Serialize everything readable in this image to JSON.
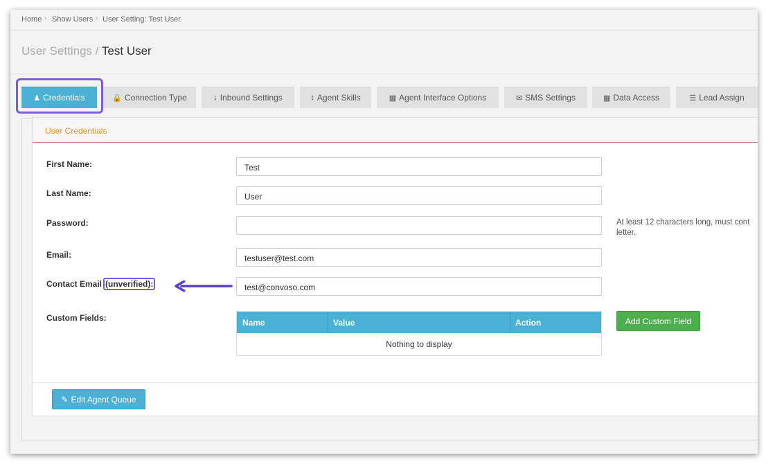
{
  "breadcrumb": {
    "home": "Home",
    "show_users": "Show Users",
    "current": "User Setting: Test User"
  },
  "page_title": {
    "prefix": "User Settings /",
    "name": "Test User"
  },
  "tabs": [
    {
      "label": "Credentials",
      "icon": "user-icon"
    },
    {
      "label": "Connection Type",
      "icon": "lock-icon"
    },
    {
      "label": "Inbound Settings",
      "icon": "arrow-down-icon"
    },
    {
      "label": "Agent Skills",
      "icon": "arrows-vertical-icon"
    },
    {
      "label": "Agent Interface Options",
      "icon": "grid-icon"
    },
    {
      "label": "SMS Settings",
      "icon": "envelope-icon"
    },
    {
      "label": "Data Access",
      "icon": "grid-icon"
    },
    {
      "label": "Lead Assign",
      "icon": "list-icon"
    }
  ],
  "panel": {
    "title": "User Credentials"
  },
  "form": {
    "first_name": {
      "label": "First Name:",
      "value": "Test"
    },
    "last_name": {
      "label": "Last Name:",
      "value": "User"
    },
    "password": {
      "label": "Password:",
      "value": "",
      "hint_line1": "At least 12 characters long, must cont",
      "hint_line2": "letter."
    },
    "email": {
      "label": "Email:",
      "value": "testuser@test.com"
    },
    "contact_email": {
      "label": "Contact Email",
      "label_tag": "(unverified):",
      "value": "test@convoso.com"
    },
    "custom_fields": {
      "label": "Custom Fields:"
    }
  },
  "custom_table": {
    "columns": [
      "Name",
      "Value",
      "Action"
    ],
    "empty_text": "Nothing to display"
  },
  "buttons": {
    "add_custom_field": "Add Custom Field",
    "edit_agent_queue": "Edit Agent Queue"
  },
  "colors": {
    "accent": "#4ab0d4",
    "green": "#4cae4c",
    "annotation": "#7c5cdb",
    "panel_title": "#ef8f1d"
  }
}
